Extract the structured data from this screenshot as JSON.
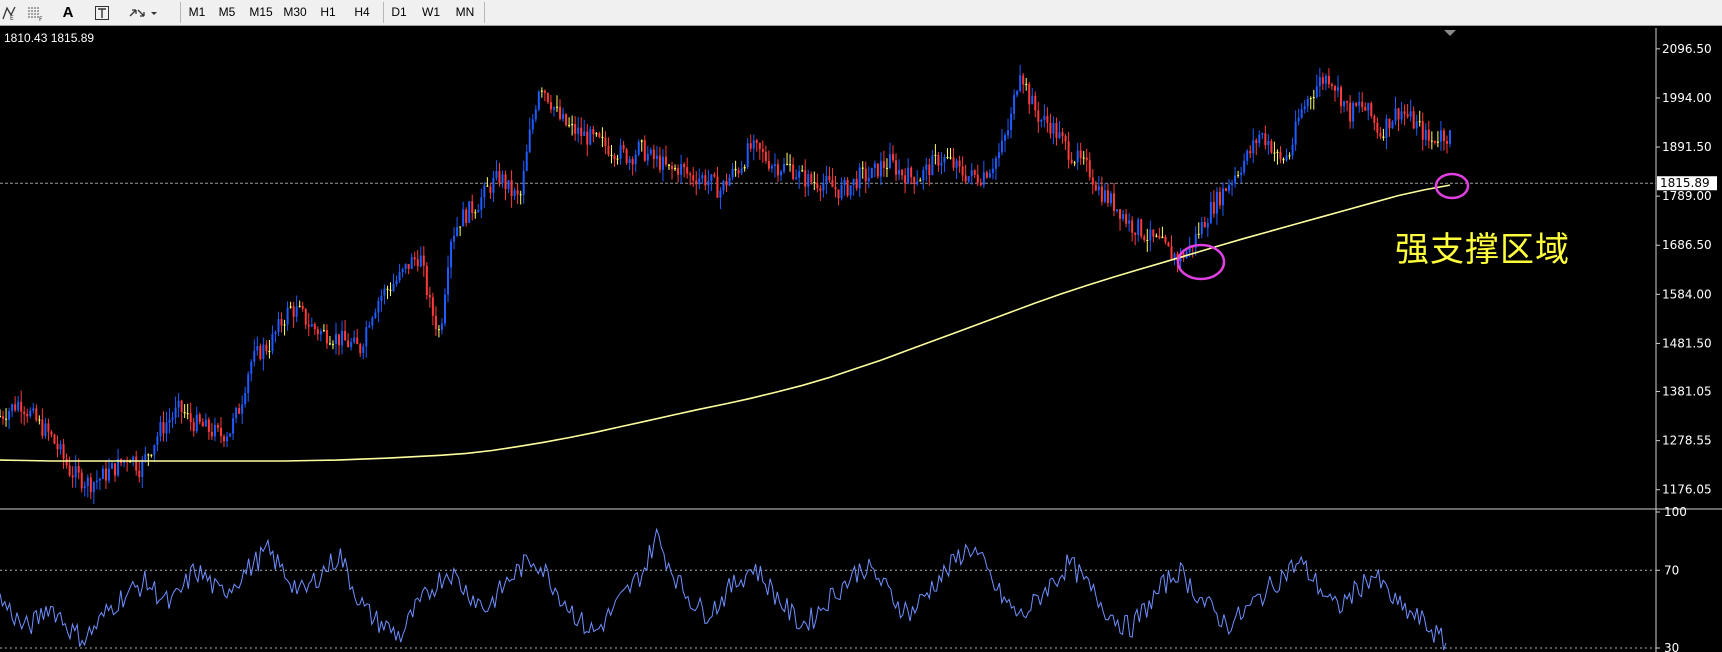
{
  "toolbar": {
    "tools": [
      {
        "name": "fibo-icon",
        "glyph": "↯"
      },
      {
        "name": "fibo-channel-icon",
        "glyph": "⋮"
      },
      {
        "name": "text-tool-icon",
        "glyph": "A"
      },
      {
        "name": "text-label-icon",
        "glyph": "T"
      },
      {
        "name": "arrows-icon",
        "glyph": "⇅"
      }
    ],
    "timeframes": [
      "M1",
      "M5",
      "M15",
      "M30",
      "H1",
      "H4",
      "D1",
      "W1",
      "MN"
    ]
  },
  "chart": {
    "ohlc_text": "1810.43 1815.89",
    "current_price_label": "1815.89",
    "annotation": "强支撑区域",
    "colors": {
      "background": "#000000",
      "moving_average": "#ffffa0",
      "up_candle": "#1e5cff",
      "down_candle": "#ff3a3a",
      "doji": "#ffff66",
      "rsi_line": "#6f8fff",
      "circle": "#e040e0",
      "annotation_text": "#ffff3c"
    }
  },
  "chart_data": [
    {
      "type": "line",
      "subtype": "candlestick_price",
      "title": "",
      "y_axis_ticks": [
        "2096.50",
        "1994.00",
        "1891.50",
        "1789.00",
        "1686.50",
        "1584.00",
        "1481.50",
        "1381.05",
        "1278.55",
        "1176.05"
      ],
      "ylim": [
        1140,
        2140
      ],
      "current_price": 1815.89,
      "series": [
        {
          "name": "",
          "role": "price",
          "values": [
            1330,
            1345,
            1360,
            1335,
            1310,
            1290,
            1255,
            1215,
            1200,
            1190,
            1200,
            1215,
            1230,
            1250,
            1220,
            1260,
            1300,
            1325,
            1345,
            1320,
            1310,
            1300,
            1290,
            1300,
            1350,
            1440,
            1465,
            1480,
            1520,
            1555,
            1545,
            1520,
            1505,
            1500,
            1490,
            1480,
            1470,
            1540,
            1580,
            1600,
            1620,
            1650,
            1665,
            1560,
            1500,
            1700,
            1740,
            1760,
            1780,
            1810,
            1830,
            1800,
            1780,
            1920,
            2030,
            1990,
            1950,
            1930,
            1920,
            1910,
            1900,
            1890,
            1880,
            1870,
            1890,
            1870,
            1860,
            1840,
            1850,
            1830,
            1830,
            1820,
            1800,
            1830,
            1850,
            1890,
            1880,
            1860,
            1850,
            1850,
            1830,
            1820,
            1820,
            1810,
            1800,
            1810,
            1830,
            1830,
            1850,
            1860,
            1840,
            1830,
            1830,
            1850,
            1870,
            1860,
            1840,
            1830,
            1830,
            1850,
            1880,
            1940,
            2060,
            1990,
            1950,
            1940,
            1910,
            1880,
            1860,
            1840,
            1800,
            1780,
            1760,
            1730,
            1720,
            1700,
            1690,
            1670,
            1660,
            1680,
            1720,
            1760,
            1790,
            1820,
            1850,
            1880,
            1920,
            1900,
            1860,
            1880,
            1960,
            2000,
            2030,
            2040,
            2000,
            1960,
            1980,
            1960,
            1920,
            1950,
            1970,
            1950,
            1930,
            1900,
            1920,
            1915
          ]
        },
        {
          "name": "",
          "role": "moving_average",
          "values": [
            1238,
            1237,
            1236,
            1236,
            1236,
            1236,
            1236,
            1236,
            1236,
            1236,
            1236,
            1236,
            1237,
            1238,
            1240,
            1242,
            1245,
            1248,
            1252,
            1258,
            1266,
            1275,
            1285,
            1296,
            1308,
            1320,
            1332,
            1344,
            1355,
            1367,
            1380,
            1394,
            1410,
            1428,
            1446,
            1466,
            1486,
            1506,
            1526,
            1546,
            1566,
            1585,
            1603,
            1620,
            1636,
            1652,
            1668,
            1684,
            1700,
            1715,
            1730,
            1745,
            1760,
            1775,
            1790,
            1802,
            1812
          ]
        }
      ]
    },
    {
      "type": "line",
      "subtype": "rsi_oscillator",
      "title": "",
      "y_axis_ticks": [
        "100",
        "70",
        "30"
      ],
      "ylim": [
        30,
        100
      ],
      "levels": [
        70,
        30
      ],
      "series": [
        {
          "name": "",
          "values": [
            55,
            48,
            40,
            44,
            52,
            46,
            38,
            35,
            42,
            50,
            56,
            60,
            64,
            58,
            52,
            60,
            70,
            66,
            58,
            62,
            68,
            74,
            80,
            72,
            64,
            58,
            66,
            72,
            78,
            62,
            50,
            44,
            40,
            36,
            48,
            56,
            64,
            70,
            62,
            56,
            50,
            58,
            66,
            72,
            76,
            68,
            58,
            50,
            42,
            38,
            46,
            54,
            62,
            70,
            88,
            74,
            62,
            54,
            48,
            52,
            60,
            66,
            72,
            64,
            56,
            48,
            42,
            46,
            54,
            60,
            66,
            72,
            68,
            60,
            52,
            48,
            56,
            64,
            70,
            78,
            82,
            72,
            60,
            52,
            46,
            52,
            60,
            66,
            74,
            66,
            58,
            50,
            44,
            40,
            48,
            56,
            64,
            70,
            62,
            54,
            48,
            42,
            46,
            52,
            58,
            64,
            70,
            74,
            66,
            58,
            50,
            56,
            62,
            68,
            60,
            52,
            48,
            44,
            38,
            32
          ]
        }
      ]
    }
  ]
}
